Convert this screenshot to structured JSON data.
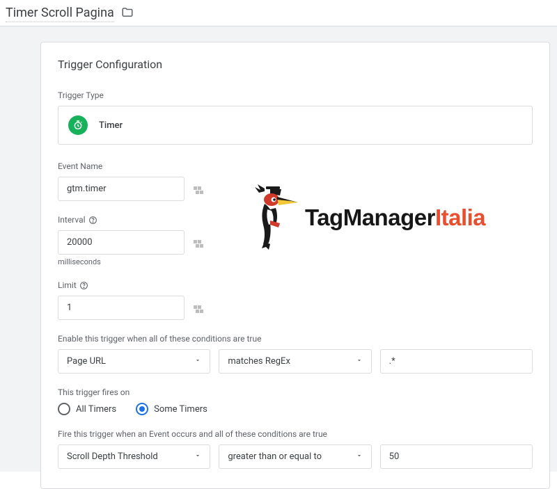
{
  "header": {
    "title": "Timer Scroll Pagina"
  },
  "panel": {
    "title": "Trigger Configuration",
    "triggerTypeLabel": "Trigger Type",
    "triggerTypeName": "Timer",
    "eventNameLabel": "Event Name",
    "eventNameValue": "gtm.timer",
    "intervalLabel": "Interval",
    "intervalValue": "20000",
    "intervalHint": "milliseconds",
    "limitLabel": "Limit",
    "limitValue": "1",
    "enableCondLabel": "Enable this trigger when all of these conditions are true",
    "enableVar": "Page URL",
    "enableOp": "matches RegEx",
    "enableVal": ".*",
    "firesOnLabel": "This trigger fires on",
    "radioAll": "All Timers",
    "radioSome": "Some Timers",
    "fireCondLabel": "Fire this trigger when an Event occurs and all of these conditions are true",
    "fireVar": "Scroll Depth Threshold",
    "fireOp": "greater than or equal to",
    "fireVal": "50"
  },
  "brand": {
    "part1": "TagManager",
    "part2": "Italia"
  }
}
